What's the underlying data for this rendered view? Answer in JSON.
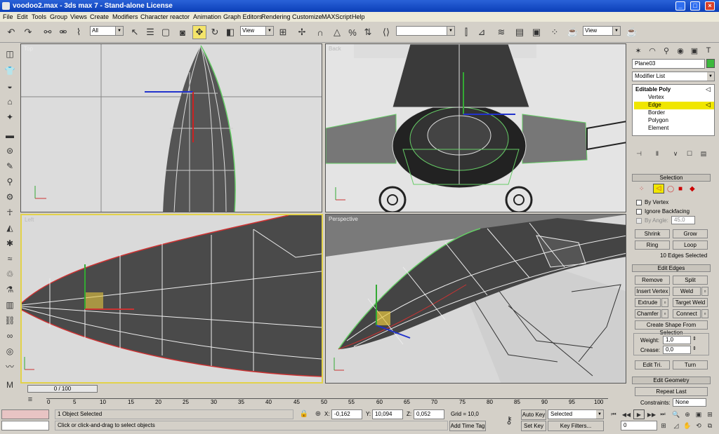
{
  "window": {
    "title": "voodoo2.max - 3ds max 7 - Stand-alone License",
    "min": "_",
    "max": "□",
    "close": "×"
  },
  "menu": [
    "File",
    "Edit",
    "Tools",
    "Group",
    "Views",
    "Create",
    "Modifiers",
    "Character",
    "reactor",
    "Animation",
    "Graph Editors",
    "Rendering",
    "Customize",
    "MAXScript",
    "Help"
  ],
  "toolbar": {
    "selection_filter": "All",
    "ref_coord": "View",
    "named_sel": "",
    "view2": "View"
  },
  "viewports": {
    "top": "Top",
    "back": "Back",
    "left": "Left",
    "persp": "Perspective"
  },
  "time": {
    "slider": "0 / 100",
    "ticks": [
      "0",
      "5",
      "10",
      "15",
      "20",
      "25",
      "30",
      "35",
      "40",
      "45",
      "50",
      "55",
      "60",
      "65",
      "70",
      "75",
      "80",
      "85",
      "90",
      "95",
      "100"
    ]
  },
  "status": {
    "objects": "1 Object Selected",
    "prompt": "Click or click-and-drag to select objects",
    "x_label": "X:",
    "x": "-0,162",
    "y_label": "Y:",
    "y": "10,094",
    "z_label": "Z:",
    "z": "0,052",
    "grid": "Grid = 10,0",
    "add_time_tag": "Add Time Tag",
    "auto_key": "Auto Key",
    "set_key": "Set Key",
    "key_mode": "Selected",
    "key_filters": "Key Filters...",
    "frame": "0"
  },
  "cmd": {
    "object_name": "Plane03",
    "modifier_list": "Modifier List",
    "stack": [
      "Editable Poly",
      "Vertex",
      "Edge",
      "Border",
      "Polygon",
      "Element"
    ],
    "selection_title": "Selection",
    "by_vertex": "By Vertex",
    "ignore_backfacing": "Ignore Backfacing",
    "by_angle": "By Angle:",
    "angle": "45,0",
    "shrink": "Shrink",
    "grow": "Grow",
    "ring": "Ring",
    "loop": "Loop",
    "selected_count": "10 Edges Selected",
    "edit_edges_title": "Edit Edges",
    "remove": "Remove",
    "split": "Split",
    "insert_vertex": "Insert Vertex",
    "weld": "Weld",
    "extrude": "Extrude",
    "target_weld": "Target Weld",
    "chamfer": "Chamfer",
    "connect": "Connect",
    "create_shape": "Create Shape From Selection",
    "weight_label": "Weight:",
    "weight": "1,0",
    "crease_label": "Crease:",
    "crease": "0,0",
    "edit_tri": "Edit Tri.",
    "turn": "Turn",
    "edit_geometry_title": "Edit Geometry",
    "repeat_last": "Repeat Last",
    "constraints": "Constraints:",
    "constraints_val": "None"
  },
  "colors": {
    "title_bar": "#0b3fb8",
    "active_viewport": "#e2d24a",
    "edge_highlight": "#ffff00",
    "mesh_wire": "#ffffff",
    "object_color": "#3cb83c"
  }
}
